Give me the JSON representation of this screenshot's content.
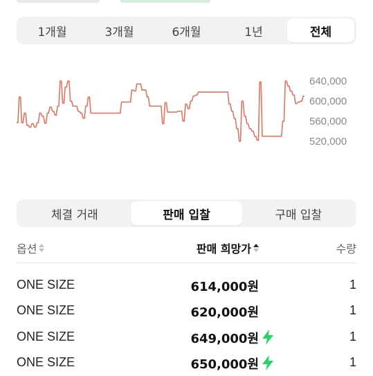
{
  "period_tabs": [
    {
      "label": "1개월",
      "active": false
    },
    {
      "label": "3개월",
      "active": false
    },
    {
      "label": "6개월",
      "active": false
    },
    {
      "label": "1년",
      "active": false
    },
    {
      "label": "전체",
      "active": true
    }
  ],
  "chart_data": {
    "type": "line",
    "title": "",
    "xlabel": "",
    "ylabel": "",
    "ylim": [
      510000,
      650000
    ],
    "y_ticks": [
      "640,000",
      "600,000",
      "560,000",
      "520,000"
    ],
    "y_tick_values": [
      640000,
      600000,
      560000,
      520000
    ],
    "series": [
      {
        "color": "#e07361",
        "values": [
          557000,
          557000,
          608000,
          608000,
          557000,
          557000,
          576000,
          576000,
          552000,
          552000,
          548000,
          548000,
          555000,
          555000,
          548000,
          548000,
          557000,
          557000,
          576000,
          576000,
          570000,
          570000,
          556000,
          556000,
          576000,
          576000,
          588000,
          588000,
          580000,
          580000,
          572000,
          572000,
          590000,
          590000,
          640000,
          640000,
          596000,
          596000,
          628000,
          628000,
          640000,
          640000,
          600000,
          600000,
          590000,
          590000,
          590000,
          590000,
          580000,
          580000,
          576000,
          576000,
          566000,
          566000,
          590000,
          590000,
          608000,
          608000,
          576000,
          576000,
          576000,
          576000,
          576000,
          576000,
          576000,
          576000,
          576000,
          576000,
          576000,
          576000,
          576000,
          576000,
          576000,
          576000,
          576000,
          576000,
          576000,
          576000,
          576000,
          576000,
          576000,
          576000,
          598000,
          598000,
          598000,
          598000,
          598000,
          598000,
          598000,
          598000,
          622000,
          622000,
          620000,
          620000,
          634000,
          634000,
          634000,
          634000,
          622000,
          622000,
          622000,
          622000,
          608000,
          608000,
          590000,
          590000,
          590000,
          590000,
          590000,
          590000,
          590000,
          590000,
          590000,
          590000,
          555000,
          555000,
          597000,
          597000,
          578000,
          578000,
          578000,
          578000,
          578000,
          578000,
          578000,
          578000,
          580000,
          580000,
          580000,
          580000,
          560000,
          560000,
          594000,
          594000,
          585000,
          585000,
          600000,
          600000,
          610000,
          610000,
          612000,
          612000,
          618000,
          618000,
          618000,
          618000,
          618000,
          618000,
          618000,
          618000,
          618000,
          618000,
          618000,
          618000,
          618000,
          618000,
          618000,
          618000,
          618000,
          618000,
          618000,
          618000,
          618000,
          618000,
          618000,
          618000,
          594000,
          594000,
          580000,
          580000,
          565000,
          565000,
          545000,
          545000,
          520000,
          520000,
          600000,
          600000,
          570000,
          570000,
          555000,
          555000,
          545000,
          545000,
          540000,
          540000,
          530000,
          530000,
          522000,
          522000,
          638000,
          638000,
          530000,
          530000,
          530000,
          530000,
          530000,
          530000,
          530000,
          530000,
          530000,
          530000,
          530000,
          530000,
          530000,
          530000,
          530000,
          530000,
          560000,
          560000,
          640000,
          640000,
          630000,
          630000,
          620000,
          620000,
          612000,
          612000,
          595000,
          595000,
          598000,
          598000,
          600000,
          600000,
          610000,
          610000
        ]
      }
    ]
  },
  "trade_tabs": [
    {
      "label": "체결 거래",
      "active": false
    },
    {
      "label": "판매 입찰",
      "active": true
    },
    {
      "label": "구매 입찰",
      "active": false
    }
  ],
  "table": {
    "headers": {
      "option": "옵션",
      "price": "판매 희망가",
      "qty": "수량"
    },
    "rows": [
      {
        "option": "ONE SIZE",
        "price": "614,000원",
        "fast": false,
        "qty": "1"
      },
      {
        "option": "ONE SIZE",
        "price": "620,000원",
        "fast": false,
        "qty": "1"
      },
      {
        "option": "ONE SIZE",
        "price": "649,000원",
        "fast": true,
        "qty": "1"
      },
      {
        "option": "ONE SIZE",
        "price": "650,000원",
        "fast": true,
        "qty": "1"
      }
    ]
  },
  "colors": {
    "line": "#e07361",
    "bolt": "#2bd16b"
  }
}
